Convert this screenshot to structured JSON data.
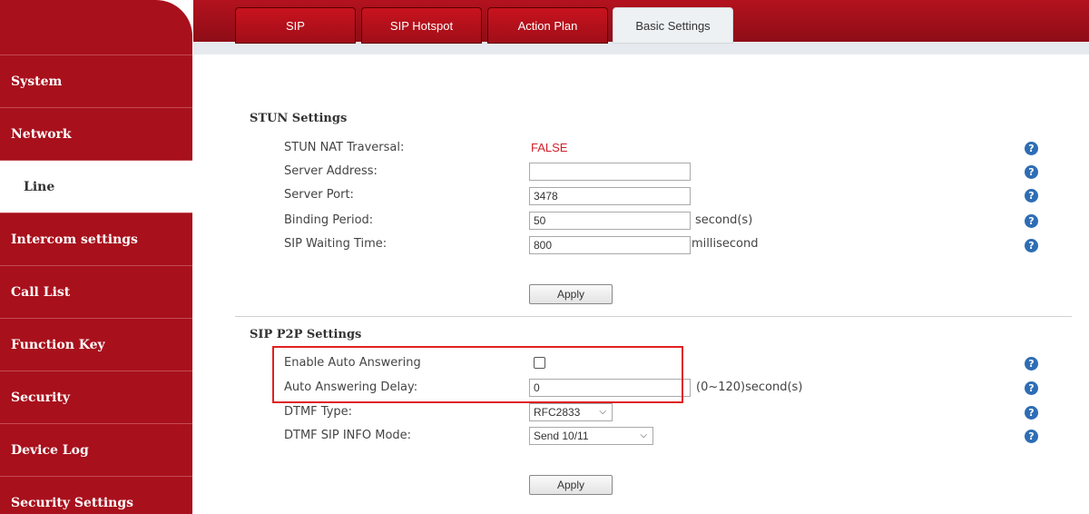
{
  "sidebar": {
    "items": [
      {
        "label": "System"
      },
      {
        "label": "Network"
      },
      {
        "label": "Line"
      },
      {
        "label": "Intercom settings"
      },
      {
        "label": "Call List"
      },
      {
        "label": "Function Key"
      },
      {
        "label": "Security"
      },
      {
        "label": "Device Log"
      },
      {
        "label": "Security Settings"
      }
    ],
    "active": "Line"
  },
  "tabs": [
    {
      "label": "SIP"
    },
    {
      "label": "SIP Hotspot"
    },
    {
      "label": "Action Plan"
    },
    {
      "label": "Basic Settings"
    }
  ],
  "active_tab": "Basic Settings",
  "stun": {
    "title": "STUN Settings",
    "nat_traversal_label": "STUN NAT Traversal:",
    "nat_traversal_value": "FALSE",
    "server_address_label": "Server Address:",
    "server_address_value": "",
    "server_port_label": "Server Port:",
    "server_port_value": "3478",
    "binding_period_label": "Binding Period:",
    "binding_period_value": "50",
    "binding_period_unit": "second(s)",
    "sip_waiting_label": "SIP Waiting Time:",
    "sip_waiting_value": "800",
    "sip_waiting_unit": "millisecond",
    "apply_label": "Apply"
  },
  "p2p": {
    "title": "SIP P2P Settings",
    "auto_answer_label": "Enable Auto Answering",
    "auto_answer_checked": false,
    "auto_delay_label": "Auto Answering Delay:",
    "auto_delay_value": "0",
    "auto_delay_unit": "(0~120)second(s)",
    "dtmf_type_label": "DTMF Type:",
    "dtmf_type_value": "RFC2833",
    "dtmf_info_label": "DTMF SIP INFO Mode:",
    "dtmf_info_value": "Send 10/11",
    "apply_label": "Apply"
  },
  "help_glyph": "?",
  "colors": {
    "brand_red": "#a8101c",
    "false_red": "#d0202a",
    "help_blue": "#2e6db4",
    "highlight_red": "#e02020"
  }
}
